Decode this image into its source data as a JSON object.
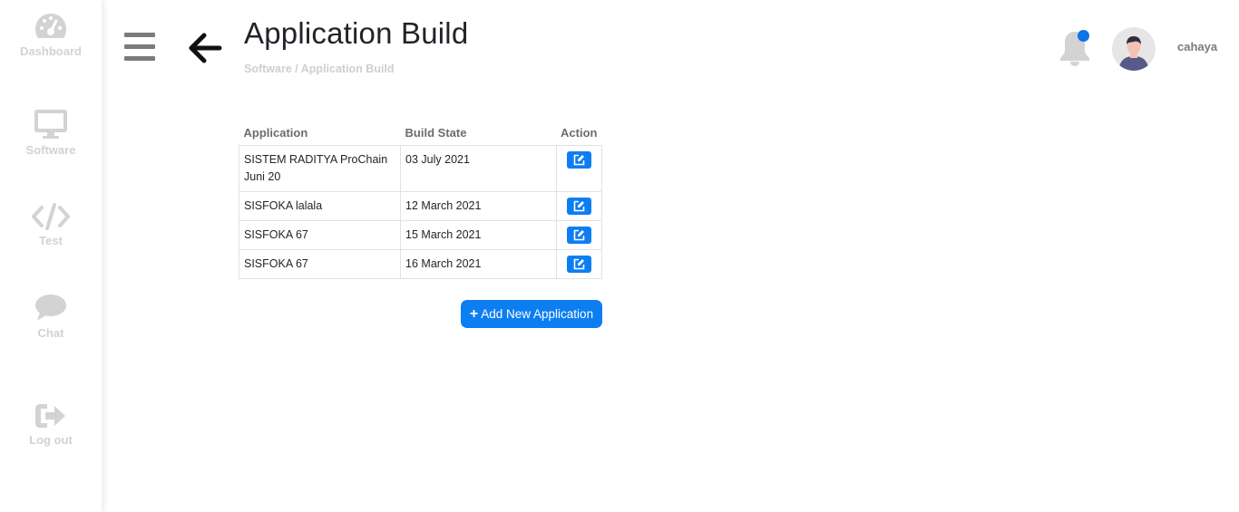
{
  "sidebar": {
    "items": [
      {
        "label": "Dashboard",
        "icon": "dashboard-gauge-icon"
      },
      {
        "label": "Software",
        "icon": "desktop-monitor-icon"
      },
      {
        "label": "Test",
        "icon": "code-icon"
      },
      {
        "label": "Chat",
        "icon": "chat-bubble-icon"
      },
      {
        "label": "Log out",
        "icon": "sign-out-icon"
      }
    ]
  },
  "header": {
    "title": "Application Build",
    "breadcrumb": {
      "parent": "Software",
      "separator": " / ",
      "current": "Application Build"
    },
    "username": "cahaya",
    "notification_dot_color": "#0d74e8"
  },
  "table": {
    "columns": [
      "Application",
      "Build State",
      "Action"
    ],
    "rows": [
      {
        "application": "SISTEM RADITYA ProChain Juni 20",
        "build_state": "03 July 2021"
      },
      {
        "application": "SISFOKA lalala",
        "build_state": "12 March 2021"
      },
      {
        "application": "SISFOKA 67",
        "build_state": "15 March 2021"
      },
      {
        "application": "SISFOKA 67",
        "build_state": "16 March 2021"
      }
    ]
  },
  "actions": {
    "add_label": "Add New Application"
  },
  "colors": {
    "accent": "#0d7ef2",
    "sidebar_text": "#d2d2d2",
    "muted": "#cfcfcf"
  }
}
